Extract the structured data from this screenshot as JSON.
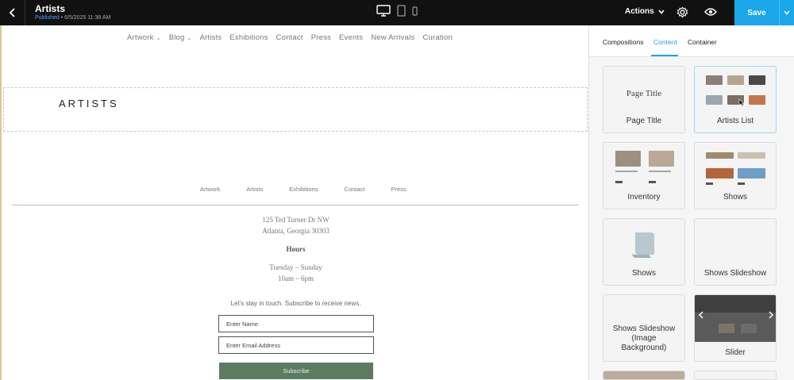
{
  "topbar": {
    "page_name": "Artists",
    "status": "Published",
    "timestamp": "6/5/2025 11:38 AM",
    "actions_label": "Actions",
    "save_label": "Save",
    "icons": [
      "back-arrow-icon",
      "desktop-icon",
      "tablet-icon",
      "mobile-icon",
      "chevron-down-icon",
      "gear-icon",
      "eye-icon"
    ]
  },
  "site": {
    "nav": [
      "Artwork",
      "Blog",
      "Artists",
      "Exhibitions",
      "Contact",
      "Press",
      "Events",
      "New Arrivals",
      "Curation"
    ],
    "page_title": "ARTISTS",
    "footer_nav": [
      "Artwork",
      "Artists",
      "Exhibitions",
      "Contact",
      "Press"
    ],
    "address_line1": "125 Ted Turner Dr NW",
    "address_line2": "Atlanta, Georgia 30303",
    "hours_heading": "Hours",
    "hours_days": "Tuesday – Sunday",
    "hours_times": "10am – 6pm",
    "newsletter_text": "Let's stay in touch. Subscribe to receive news.",
    "name_placeholder": "Enter Name",
    "email_placeholder": "Enter Email Address",
    "subscribe_label": "Subscribe"
  },
  "panel": {
    "tabs": [
      "Compositions",
      "Content",
      "Container"
    ],
    "active_tab": "Content",
    "cards": [
      {
        "label": "Page Title",
        "preview_text": "Page Title"
      },
      {
        "label": "Artists List"
      },
      {
        "label": "Inventory"
      },
      {
        "label": "Shows"
      },
      {
        "label": "Shows"
      },
      {
        "label": "Shows Slideshow"
      },
      {
        "label": "Shows Slideshow (Image Background)"
      },
      {
        "label": "Slider"
      }
    ]
  },
  "colors": {
    "topbar": "#111111",
    "accent": "#1aa6e8",
    "subscribe": "#5d7b63"
  }
}
